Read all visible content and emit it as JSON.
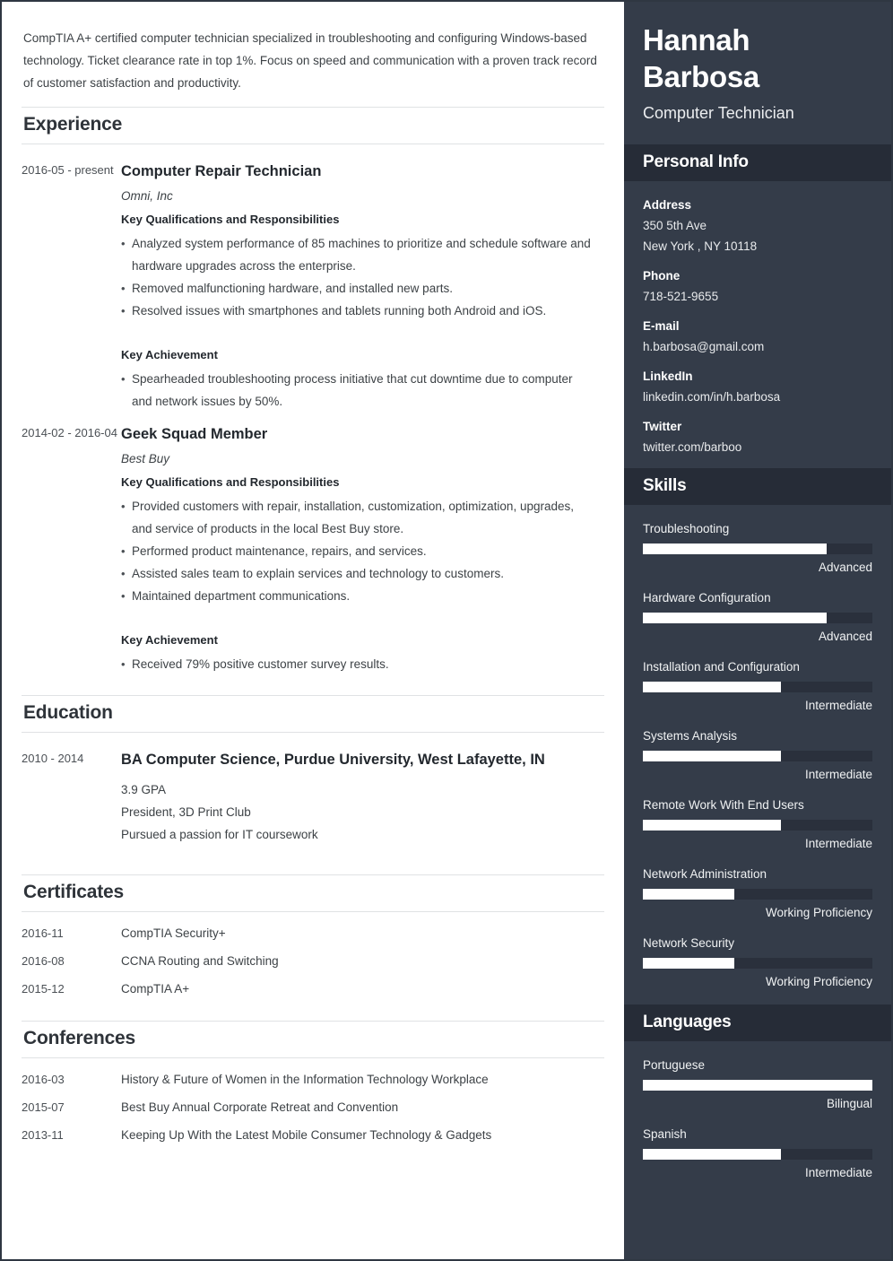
{
  "summary": "CompTIA A+ certified computer technician specialized in troubleshooting and configuring Windows-based technology. Ticket clearance rate in top 1%. Focus on speed and communication with a proven track record of customer satisfaction and productivity.",
  "sections": {
    "experience_title": "Experience",
    "education_title": "Education",
    "certificates_title": "Certificates",
    "conferences_title": "Conferences"
  },
  "labels": {
    "qualifications": "Key Qualifications and Responsibilities",
    "achievement": "Key Achievement"
  },
  "experience": [
    {
      "date": "2016-05 - present",
      "title": "Computer Repair Technician",
      "org": "Omni, Inc",
      "bullets": [
        "Analyzed system performance of 85 machines to prioritize and schedule software and hardware upgrades across the enterprise.",
        "Removed malfunctioning hardware, and installed new parts.",
        "Resolved issues with smartphones and tablets running both Android and iOS."
      ],
      "achievements": [
        "Spearheaded troubleshooting process initiative that cut downtime due to computer and network issues by 50%."
      ]
    },
    {
      "date": "2014-02 - 2016-04",
      "title": "Geek Squad Member",
      "org": "Best Buy",
      "bullets": [
        "Provided customers with repair, installation, customization, optimization, upgrades, and service of products in the local Best Buy store.",
        "Performed product maintenance, repairs, and services.",
        "Assisted sales team to explain services and technology to customers.",
        "Maintained department communications."
      ],
      "achievements": [
        "Received 79% positive customer survey results."
      ]
    }
  ],
  "education": [
    {
      "date": "2010 - 2014",
      "title": "BA Computer Science, Purdue University, West Lafayette, IN",
      "details": [
        "3.9 GPA",
        "President, 3D Print Club",
        "Pursued a passion for IT coursework"
      ]
    }
  ],
  "certificates": [
    {
      "date": "2016-11",
      "text": "CompTIA Security+"
    },
    {
      "date": "2016-08",
      "text": "CCNA Routing and Switching"
    },
    {
      "date": "2015-12",
      "text": "CompTIA A+"
    }
  ],
  "conferences": [
    {
      "date": "2016-03",
      "text": "History & Future of Women in the Information Technology Workplace"
    },
    {
      "date": "2015-07",
      "text": "Best Buy Annual Corporate Retreat and Convention"
    },
    {
      "date": "2013-11",
      "text": "Keeping Up With the Latest Mobile Consumer Technology & Gadgets"
    }
  ],
  "sidebar": {
    "name_line1": "Hannah",
    "name_line2": "Barbosa",
    "role": "Computer Technician",
    "personal_info_title": "Personal Info",
    "skills_title": "Skills",
    "languages_title": "Languages",
    "personal_info": [
      {
        "label": "Address",
        "values": [
          "350 5th Ave",
          "New York , NY 10118"
        ]
      },
      {
        "label": "Phone",
        "values": [
          "718-521-9655"
        ]
      },
      {
        "label": "E-mail",
        "values": [
          "h.barbosa@gmail.com"
        ]
      },
      {
        "label": "LinkedIn",
        "values": [
          "linkedin.com/in/h.barbosa"
        ]
      },
      {
        "label": "Twitter",
        "values": [
          "twitter.com/barboo"
        ]
      }
    ],
    "skills": [
      {
        "name": "Troubleshooting",
        "level": "Advanced",
        "percent": 80
      },
      {
        "name": "Hardware Configuration",
        "level": "Advanced",
        "percent": 80
      },
      {
        "name": "Installation and Configuration",
        "level": "Intermediate",
        "percent": 60
      },
      {
        "name": "Systems Analysis",
        "level": "Intermediate",
        "percent": 60
      },
      {
        "name": "Remote Work With End Users",
        "level": "Intermediate",
        "percent": 60
      },
      {
        "name": "Network Administration",
        "level": "Working Proficiency",
        "percent": 40
      },
      {
        "name": "Network Security",
        "level": "Working Proficiency",
        "percent": 40
      }
    ],
    "languages": [
      {
        "name": "Portuguese",
        "level": "Bilingual",
        "percent": 100
      },
      {
        "name": "Spanish",
        "level": "Intermediate",
        "percent": 60
      }
    ]
  },
  "colors": {
    "sidebar_bg": "#343c49",
    "sidebar_header_bg": "#262c37",
    "bar_track": "#2a303c",
    "bar_fill": "#ffffff",
    "page_border": "#2f3742",
    "divider": "#e0e2e4"
  }
}
